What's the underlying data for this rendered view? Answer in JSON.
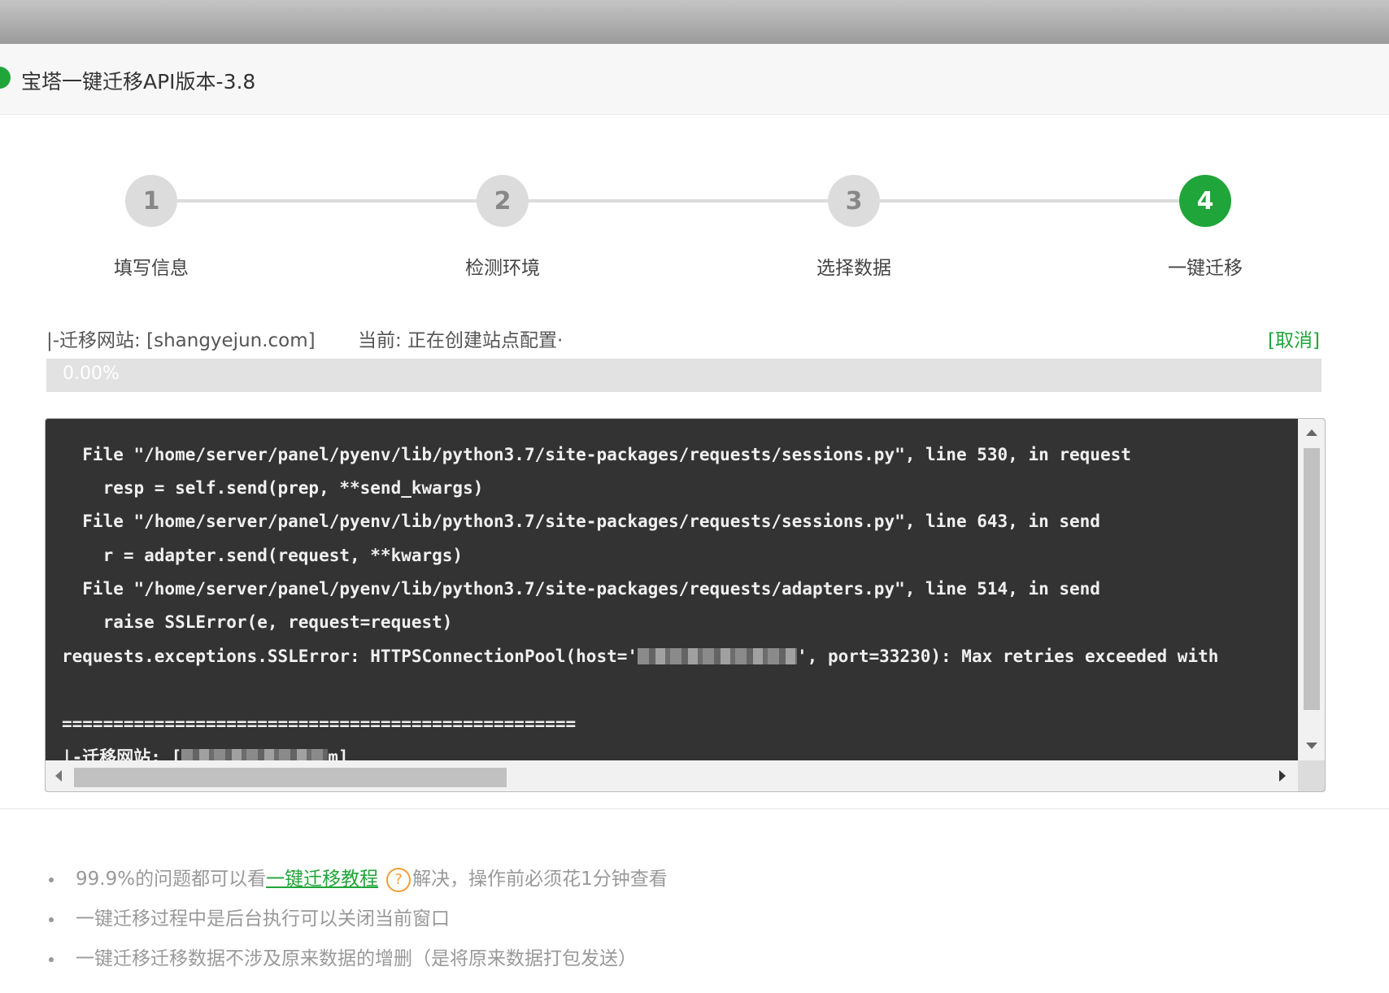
{
  "window": {
    "title": "宝塔一键迁移API版本-3.8"
  },
  "steps": [
    {
      "number": "1",
      "label": "填写信息"
    },
    {
      "number": "2",
      "label": "检测环境"
    },
    {
      "number": "3",
      "label": "选择数据"
    },
    {
      "number": "4",
      "label": "一键迁移"
    }
  ],
  "active_step": 4,
  "status": {
    "site": "|-迁移网站: [shangyejun.com]",
    "current": "当前: 正在创建站点配置·",
    "cancel_label": "[取消]"
  },
  "progress": {
    "value": 0.0,
    "label": "0.00%"
  },
  "console": {
    "lines": [
      "  File \"/home/server/panel/pyenv/lib/python3.7/site-packages/requests/sessions.py\", line 530, in request",
      "    resp = self.send(prep, **send_kwargs)",
      "  File \"/home/server/panel/pyenv/lib/python3.7/site-packages/requests/sessions.py\", line 643, in send",
      "    r = adapter.send(request, **kwargs)",
      "  File \"/home/server/panel/pyenv/lib/python3.7/site-packages/requests/adapters.py\", line 514, in send",
      "    raise SSLError(e, request=request)",
      "requests.exceptions.SSLError: HTTPSConnectionPool(host='",
      "', port=33230): Max retries exceeded with",
      "==================================================",
      "|-迁移网站: [",
      "m]"
    ]
  },
  "tips": {
    "tip1_prefix": "99.9%的问题都可以看",
    "tip1_link": "一键迁移教程",
    "tip1_help": "?",
    "tip1_suffix": "解决，操作前必须花1分钟查看",
    "tip2": "一键迁移过程中是后台执行可以关闭当前窗口",
    "tip3": "一键迁移迁移数据不涉及原来数据的增删（是将原来数据打包发送）"
  },
  "colors": {
    "accent": "#20a53a",
    "console_bg": "#333333",
    "help_icon": "#f0a033"
  },
  "icons": {
    "app": "check-circle-icon",
    "help": "question-circle-icon"
  }
}
